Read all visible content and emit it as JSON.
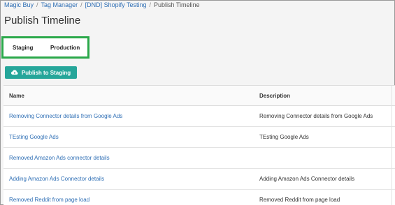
{
  "breadcrumb": {
    "items": [
      "Magic Buy",
      "Tag Manager",
      "[DND] Shopify Testing"
    ],
    "current": "Publish Timeline",
    "separator": "/"
  },
  "page": {
    "title": "Publish Timeline"
  },
  "tabs": [
    {
      "label": "Staging",
      "active": true
    },
    {
      "label": "Production",
      "active": false
    }
  ],
  "actions": {
    "publish_label": "Publish to Staging",
    "publish_icon": "cloud-upload-icon"
  },
  "table": {
    "columns": [
      "Name",
      "Description"
    ],
    "rows": [
      {
        "name": "Removing Connector details from Google Ads",
        "description": "Removing Connector details from Google Ads"
      },
      {
        "name": "TEsting Google Ads",
        "description": "TEsting Google Ads"
      },
      {
        "name": "Removed Amazon Ads connector details",
        "description": ""
      },
      {
        "name": "Adding Amazon Ads Connector details",
        "description": "Adding Amazon Ads Connector details"
      },
      {
        "name": "Removed Reddit from page load",
        "description": "Removed Reddit from page load"
      }
    ]
  },
  "colors": {
    "link": "#2f6fb5",
    "accent": "#26a69a",
    "highlight": "#2aa84a"
  }
}
